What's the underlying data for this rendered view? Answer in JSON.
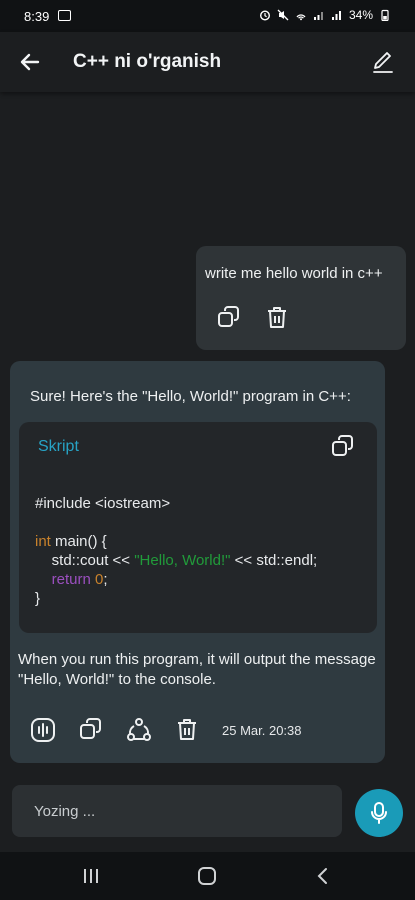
{
  "status_bar": {
    "time": "8:39",
    "battery": "34%",
    "icons": [
      "image-icon",
      "alarm-icon",
      "mute-icon",
      "hotspot-icon",
      "signal-icon",
      "signal-icon",
      "battery-icon"
    ]
  },
  "app_bar": {
    "title": "C++ ni o'rganish",
    "back_icon": "arrow-left-icon",
    "edit_icon": "pencil-icon"
  },
  "user_message": {
    "text": "write me hello world in c++",
    "actions": [
      "copy-icon",
      "trash-icon"
    ]
  },
  "bot_message": {
    "intro": "Sure! Here's the \"Hello, World!\" program in C++:",
    "code_block": {
      "language_label": "Skript",
      "line1": "#include <iostream>",
      "kw_int": "int",
      "main_sig": " main() {",
      "cout_pre": "    std::cout << ",
      "string_lit": "\"Hello, World!\"",
      "cout_post": " << std::endl;",
      "ret_kw": "    return",
      "ret_val": " 0",
      "ret_semi": ";",
      "close": "}"
    },
    "outro": "When you run this program, it will output the message \"Hello, World!\" to the console.",
    "actions": [
      "speaker-icon",
      "copy-icon",
      "share-icon",
      "trash-icon"
    ],
    "timestamp": "25 Mar. 20:38"
  },
  "composer": {
    "placeholder": "Yozing ..."
  },
  "colors": {
    "accent": "#1a9bb8",
    "language_label": "#27a3c5",
    "keyword": "#c8822c",
    "string": "#219b3a",
    "return_kw": "#9b4fbf"
  }
}
